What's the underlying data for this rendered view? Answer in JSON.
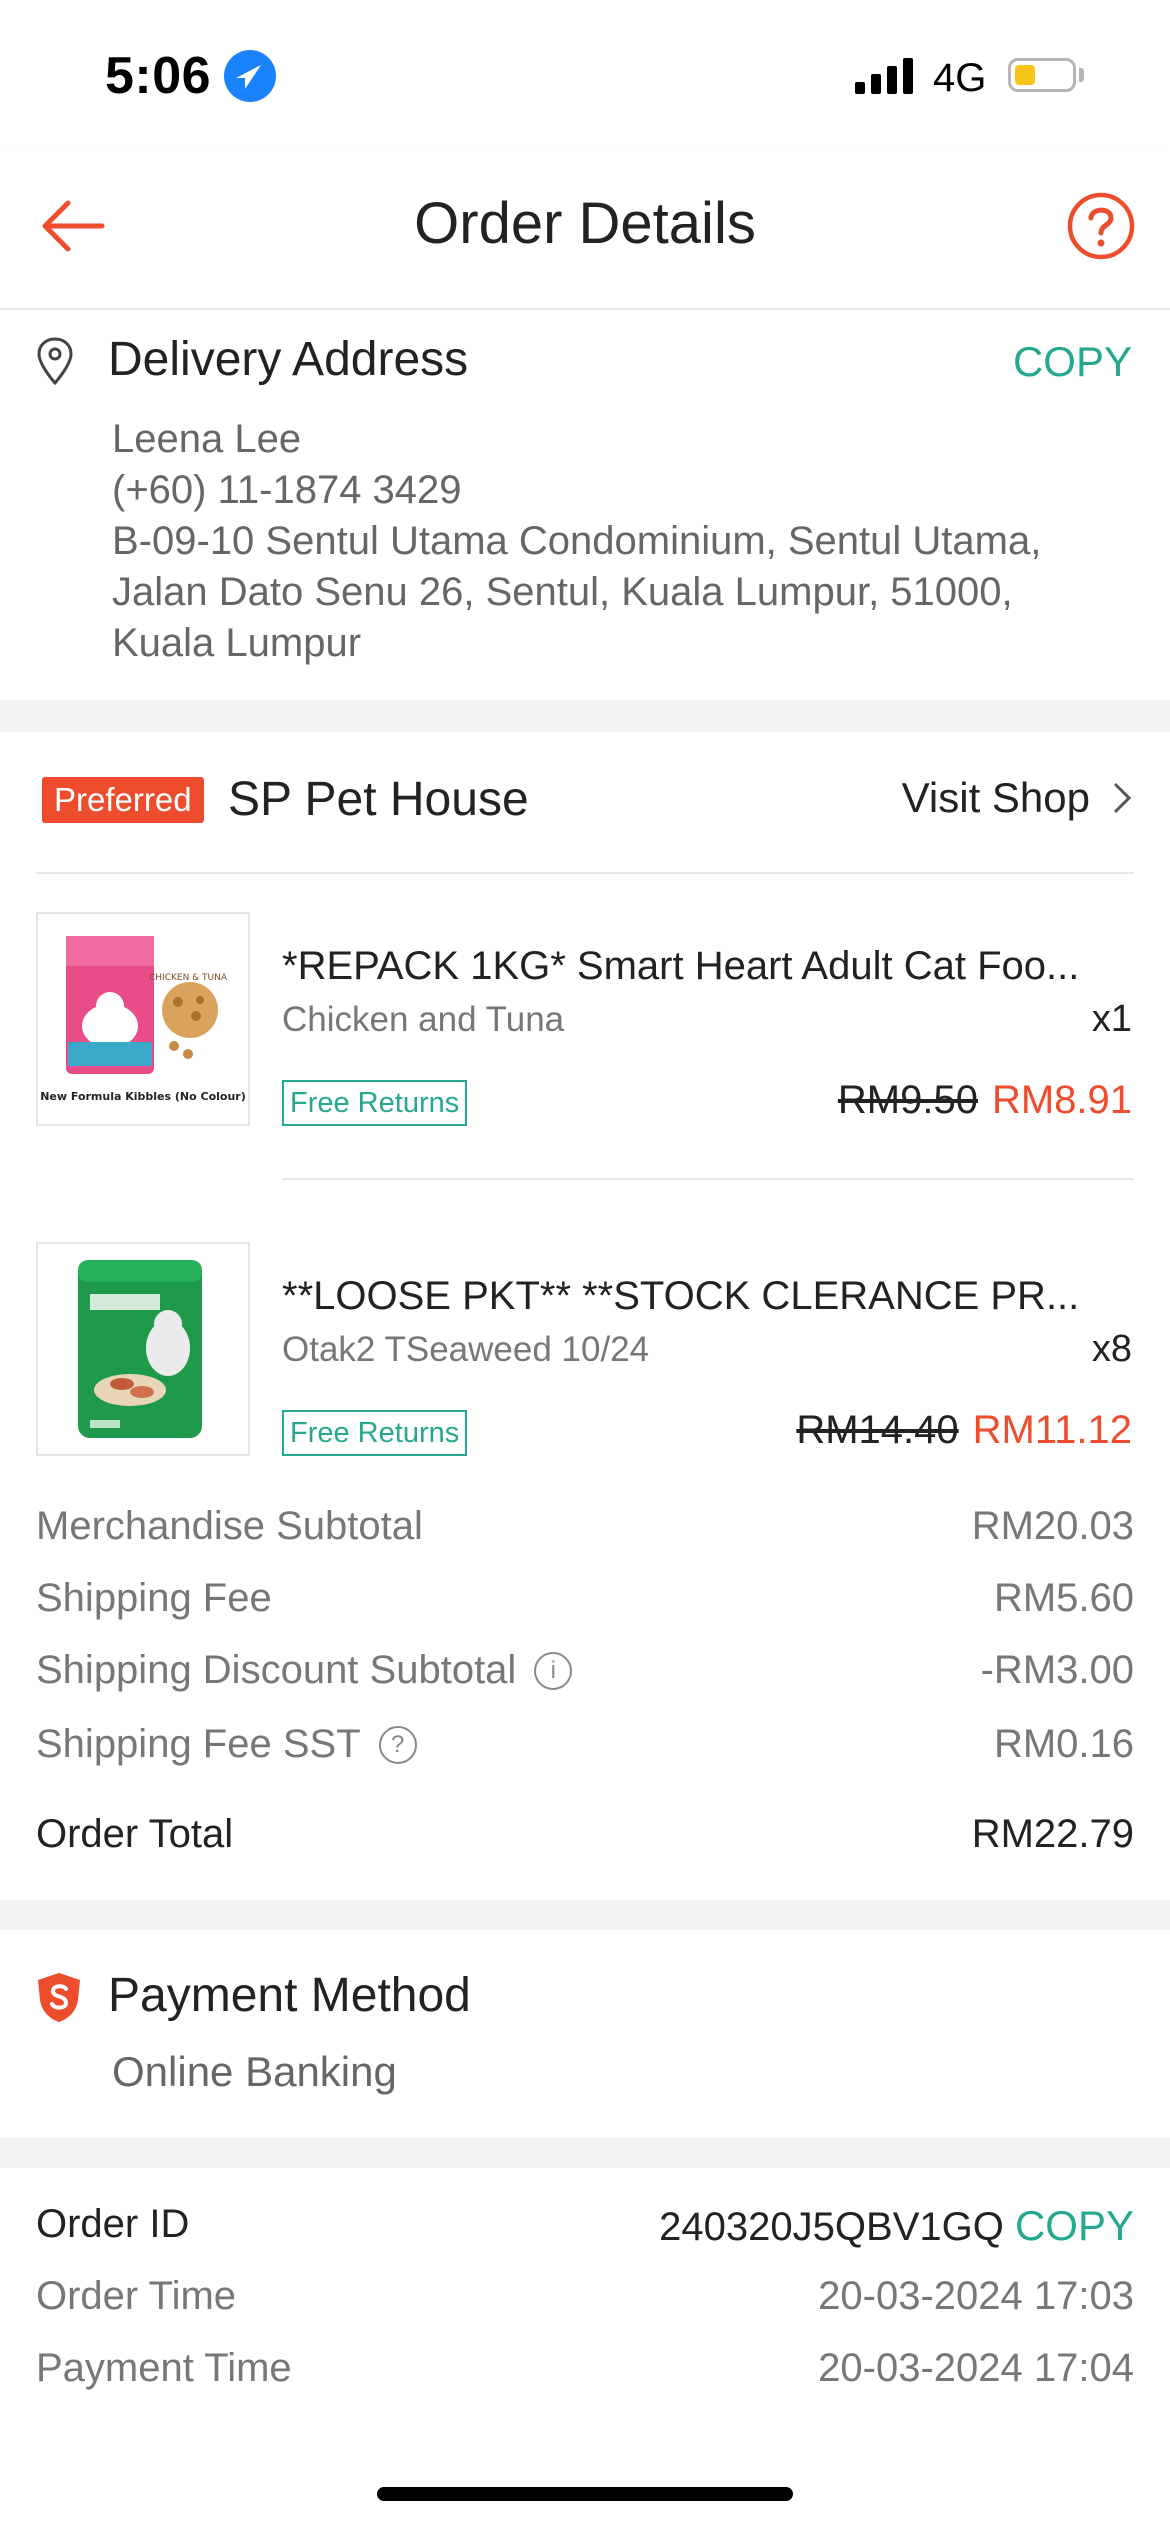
{
  "status_bar": {
    "time": "5:06",
    "network": "4G",
    "battery_level": 0.25
  },
  "header": {
    "title": "Order Details"
  },
  "address": {
    "title": "Delivery Address",
    "copy_label": "COPY",
    "name": "Leena Lee",
    "phone": "(+60) 11-1874 3429",
    "line1": "B-09-10 Sentul Utama Condominium, Sentul Utama,",
    "line2": "Jalan Dato Senu 26, Sentul, Kuala Lumpur, 51000,",
    "line3": "Kuala Lumpur"
  },
  "shop": {
    "badge": "Preferred",
    "name": "SP Pet House",
    "visit_label": "Visit Shop"
  },
  "products": [
    {
      "name": "*REPACK 1KG* Smart Heart Adult Cat Foo...",
      "variation": "Chicken and Tuna",
      "qty": "x1",
      "badge": "Free Returns",
      "price_old": "RM9.50",
      "price_new": "RM8.91",
      "thumb_caption": "New Formula Kibbles (No Colour)",
      "thumb_tag": "CHICKEN & TUNA"
    },
    {
      "name": "**LOOSE PKT** **STOCK CLERANCE PR...",
      "variation": "Otak2 TSeaweed 10/24",
      "qty": "x8",
      "badge": "Free Returns",
      "price_old": "RM14.40",
      "price_new": "RM11.12"
    }
  ],
  "summary": {
    "merch_label": "Merchandise Subtotal",
    "merch_value": "RM20.03",
    "ship_label": "Shipping Fee",
    "ship_value": "RM5.60",
    "ship_disc_label": "Shipping Discount Subtotal",
    "ship_disc_value": "-RM3.00",
    "sst_label": "Shipping Fee SST",
    "sst_value": "RM0.16",
    "total_label": "Order Total",
    "total_value": "RM22.79"
  },
  "payment": {
    "title": "Payment Method",
    "method": "Online Banking"
  },
  "order": {
    "id_label": "Order ID",
    "id_value": "240320J5QBV1GQ",
    "copy_label": "COPY",
    "time_label": "Order Time",
    "time_value": "20-03-2024 17:03",
    "pay_time_label": "Payment Time",
    "pay_time_value": "20-03-2024 17:04"
  },
  "colors": {
    "brand": "#ee4d2d",
    "accent": "#25a88f",
    "link_blue": "#1a82fb"
  }
}
